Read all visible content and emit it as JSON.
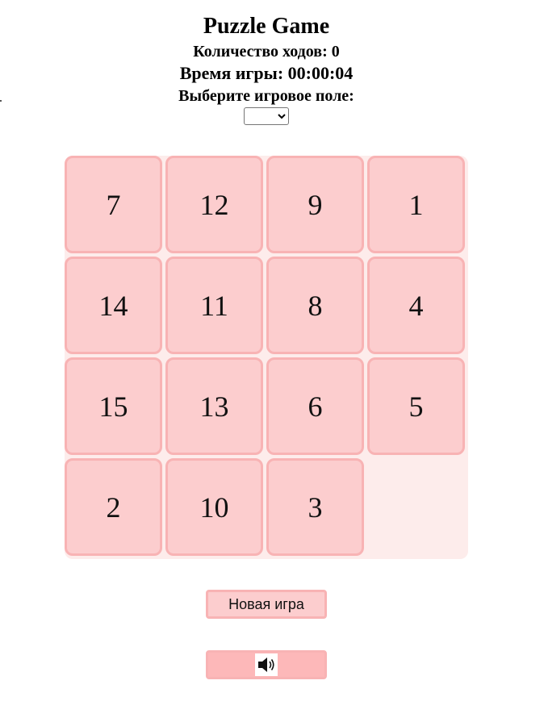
{
  "header": {
    "title": "Puzzle Game",
    "moves_text": "Количество ходов: 0",
    "time_text": "Время игры: 00:00:04",
    "choose_text": "Выберите игровое поле:"
  },
  "board_select": {
    "selected": ""
  },
  "board": {
    "size": 4,
    "tiles": [
      {
        "label": "7",
        "row": 0,
        "col": 0
      },
      {
        "label": "12",
        "row": 0,
        "col": 1
      },
      {
        "label": "9",
        "row": 0,
        "col": 2
      },
      {
        "label": "1",
        "row": 0,
        "col": 3
      },
      {
        "label": "14",
        "row": 1,
        "col": 0
      },
      {
        "label": "11",
        "row": 1,
        "col": 1
      },
      {
        "label": "8",
        "row": 1,
        "col": 2
      },
      {
        "label": "4",
        "row": 1,
        "col": 3
      },
      {
        "label": "15",
        "row": 2,
        "col": 0
      },
      {
        "label": "13",
        "row": 2,
        "col": 1
      },
      {
        "label": "6",
        "row": 2,
        "col": 2
      },
      {
        "label": "5",
        "row": 2,
        "col": 3
      },
      {
        "label": "2",
        "row": 3,
        "col": 0
      },
      {
        "label": "10",
        "row": 3,
        "col": 1
      },
      {
        "label": "3",
        "row": 3,
        "col": 2
      }
    ],
    "empty": {
      "row": 3,
      "col": 3
    }
  },
  "controls": {
    "new_game_label": "Новая игра",
    "sound_icon": "speaker-icon"
  },
  "colors": {
    "tile_fill": "#fccdce",
    "tile_border": "#f8b3b4",
    "board_bg": "#fdeceb",
    "sound_button_fill": "#fdb8b9"
  }
}
